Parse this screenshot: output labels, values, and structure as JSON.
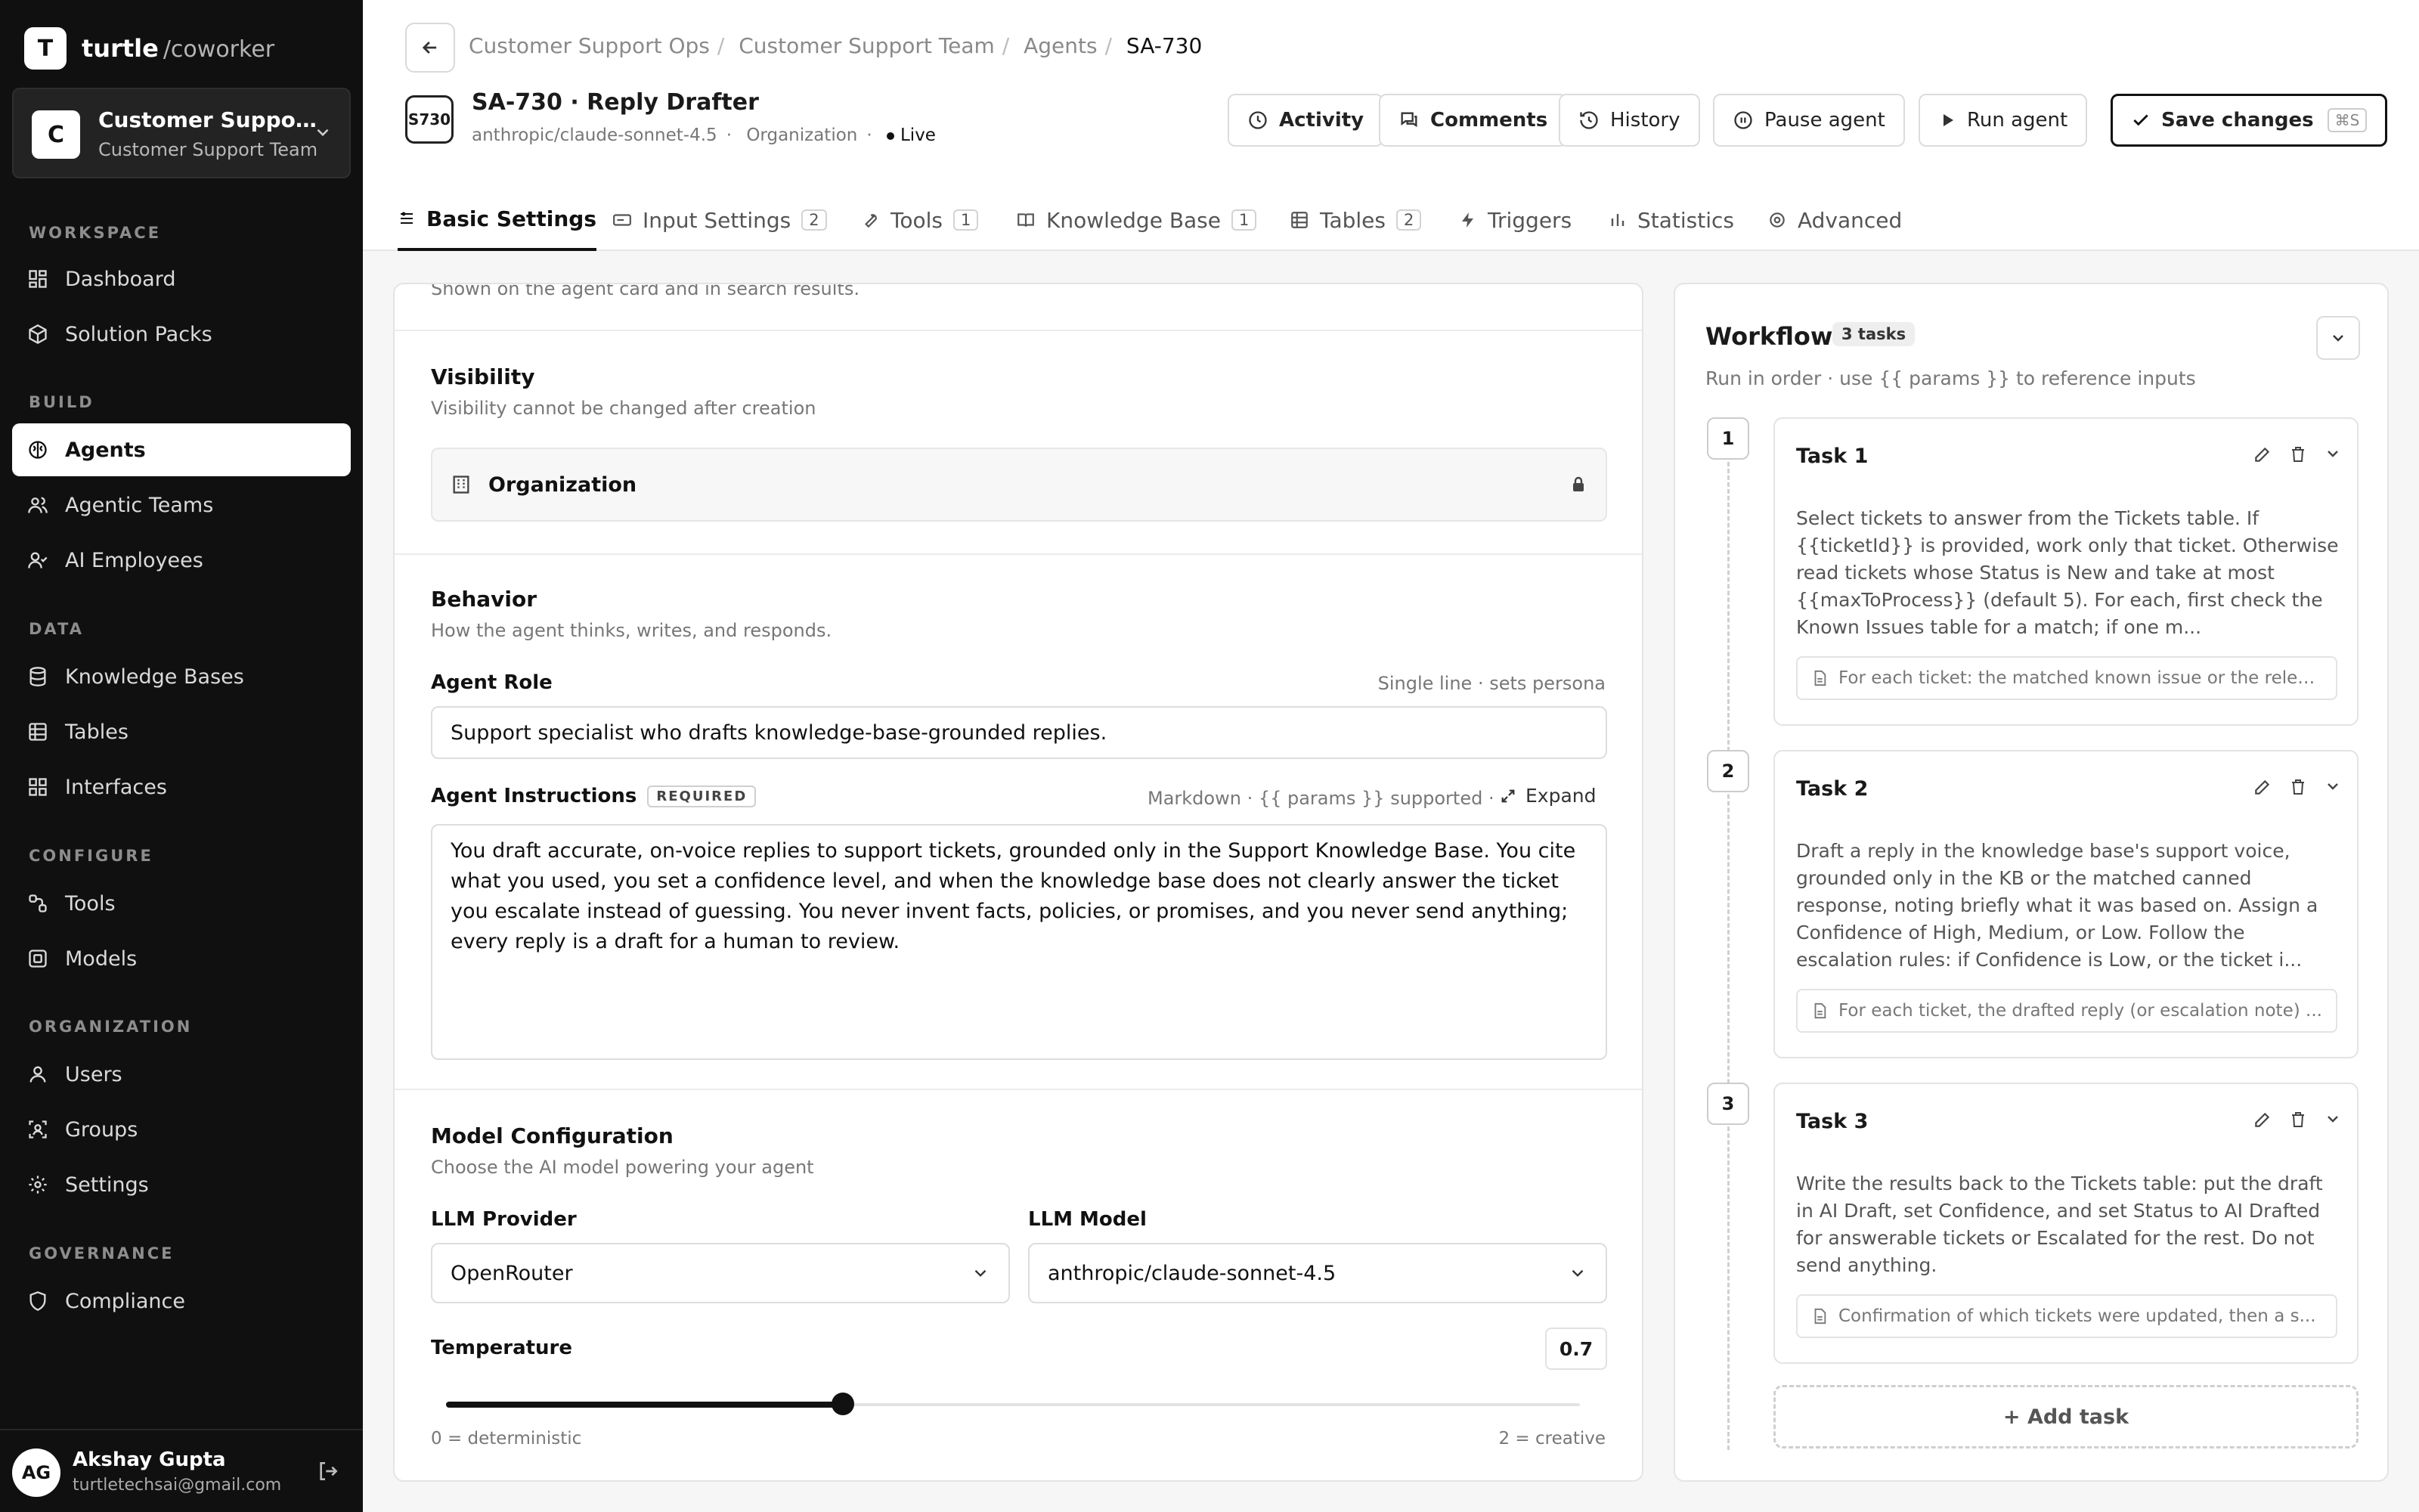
{
  "brand": {
    "logo": "T",
    "name": "turtle",
    "suffix": "/coworker"
  },
  "workspace": {
    "avatar": "C",
    "title": "Customer Support Ops",
    "subtitle": "Customer Support Team"
  },
  "sidebar": {
    "sections": [
      "WORKSPACE",
      "BUILD",
      "DATA",
      "CONFIGURE",
      "ORGANIZATION",
      "GOVERNANCE"
    ],
    "items": [
      {
        "label": "Dashboard",
        "icon": "dashboard-icon"
      },
      {
        "label": "Solution Packs",
        "icon": "package-icon"
      },
      {
        "label": "Agents",
        "icon": "brain-icon",
        "active": true
      },
      {
        "label": "Agentic Teams",
        "icon": "team-icon"
      },
      {
        "label": "AI Employees",
        "icon": "user-check-icon"
      },
      {
        "label": "Knowledge Bases",
        "icon": "database-icon"
      },
      {
        "label": "Tables",
        "icon": "table-icon"
      },
      {
        "label": "Interfaces",
        "icon": "grid-icon"
      },
      {
        "label": "Tools",
        "icon": "tool-icon"
      },
      {
        "label": "Models",
        "icon": "model-icon"
      },
      {
        "label": "Users",
        "icon": "user-icon"
      },
      {
        "label": "Groups",
        "icon": "group-icon"
      },
      {
        "label": "Settings",
        "icon": "gear-icon"
      },
      {
        "label": "Compliance",
        "icon": "shield-icon"
      }
    ]
  },
  "user": {
    "initials": "AG",
    "name": "Akshay Gupta",
    "email": "turtletechsai@gmail.com"
  },
  "breadcrumb": [
    "Customer Support Ops",
    "Customer Support Team",
    "Agents",
    "SA-730"
  ],
  "agent": {
    "badge": "S730",
    "title": "SA-730 · Reply Drafter",
    "model": "anthropic/claude-sonnet-4.5",
    "scope": "Organization",
    "status": "Live"
  },
  "header_buttons": {
    "activity": "Activity",
    "comments": "Comments",
    "history": "History",
    "pause": "Pause agent",
    "run": "Run agent",
    "save": "Save changes",
    "save_kbd": "⌘S"
  },
  "tabs": [
    {
      "label": "Basic Settings",
      "count": ""
    },
    {
      "label": "Input Settings",
      "count": "2"
    },
    {
      "label": "Tools",
      "count": "1"
    },
    {
      "label": "Knowledge Base",
      "count": "1"
    },
    {
      "label": "Tables",
      "count": "2"
    },
    {
      "label": "Triggers",
      "count": ""
    },
    {
      "label": "Statistics",
      "count": ""
    },
    {
      "label": "Advanced",
      "count": ""
    }
  ],
  "form": {
    "top_hint": "Shown on the agent card and in search results.",
    "visibility": {
      "title": "Visibility",
      "hint": "Visibility cannot be changed after creation",
      "value": "Organization"
    },
    "behavior": {
      "title": "Behavior",
      "hint": "How the agent thinks, writes, and responds."
    },
    "role": {
      "label": "Agent Role",
      "hint": "Single line · sets persona",
      "value": "Support specialist who drafts knowledge-base-grounded replies."
    },
    "instructions": {
      "label": "Agent Instructions",
      "required": "REQUIRED",
      "hint": "Markdown · {{ params }} supported ·",
      "expand": "Expand",
      "value": "You draft accurate, on-voice replies to support tickets, grounded only in the Support Knowledge Base. You cite what you used, you set a confidence level, and when the knowledge base does not clearly answer the ticket you escalate instead of guessing. You never invent facts, policies, or promises, and you never send anything; every reply is a draft for a human to review."
    },
    "model_config": {
      "title": "Model Configuration",
      "hint": "Choose the AI model powering your agent"
    },
    "provider": {
      "label": "LLM Provider",
      "value": "OpenRouter"
    },
    "llm_model": {
      "label": "LLM Model",
      "value": "anthropic/claude-sonnet-4.5"
    },
    "temperature": {
      "label": "Temperature",
      "value": "0.7",
      "min_label": "0 = deterministic",
      "max_label": "2 = creative",
      "fraction": 0.35
    }
  },
  "workflow": {
    "title": "Workflow",
    "count": "3 tasks",
    "desc": "Run in order · use {{ params }} to reference inputs",
    "tasks": [
      {
        "step": "1",
        "name": "Task 1",
        "body": "Select tickets to answer from the Tickets table. If {{ticketId}} is provided, work only that ticket. Otherwise read tickets whose Status is New and take at most {{maxToProcess}} (default 5). For each, first check the Known Issues table for a match; if one m...",
        "output": "For each ticket: the matched known issue or the relev..."
      },
      {
        "step": "2",
        "name": "Task 2",
        "body": "Draft a reply in the knowledge base's support voice, grounded only in the KB or the matched canned response, noting briefly what it was based on. Assign a Confidence of High, Medium, or Low. Follow the escalation rules: if Confidence is Low, or the ticket i...",
        "output": "For each ticket, the drafted reply (or escalation note) ..."
      },
      {
        "step": "3",
        "name": "Task 3",
        "body": "Write the results back to the Tickets table: put the draft in AI Draft, set Confidence, and set Status to AI Drafted for answerable tickets or Escalated for the rest. Do not send anything.",
        "output": "Confirmation of which tickets were updated, then a s..."
      }
    ],
    "add_task": "+ Add task"
  }
}
